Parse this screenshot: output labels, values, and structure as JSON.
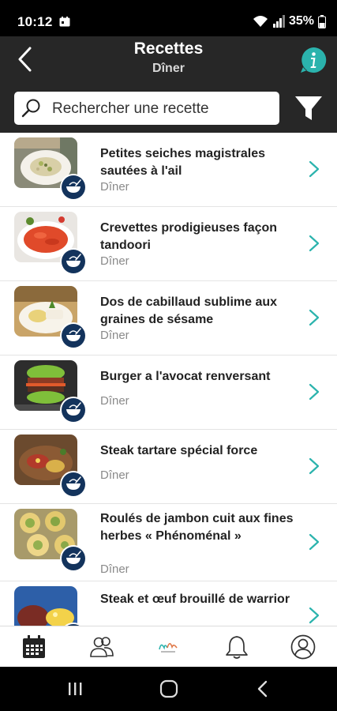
{
  "status_bar": {
    "time": "10:12",
    "battery_pct": "35%"
  },
  "header": {
    "title": "Recettes",
    "subtitle": "Dîner"
  },
  "search": {
    "placeholder": "Rechercher une recette"
  },
  "recipes": [
    {
      "title": "Petites seiches magistrales sautées à l'ail",
      "category": "Dîner"
    },
    {
      "title": "Crevettes prodigieuses façon tandoori",
      "category": "Dîner"
    },
    {
      "title": "Dos de cabillaud sublime aux graines de sésame",
      "category": "Dîner"
    },
    {
      "title": "Burger a l'avocat renversant",
      "category": "Dîner"
    },
    {
      "title": "Steak tartare spécial force",
      "category": "Dîner"
    },
    {
      "title": "Roulés de jambon cuit aux fines herbes « Phénoménal »",
      "category": "Dîner"
    },
    {
      "title": "Steak et œuf brouillé de warrior",
      "category": ""
    }
  ],
  "colors": {
    "accent": "#2bb3ad",
    "badge": "#13335c",
    "header_bg": "#272727"
  }
}
